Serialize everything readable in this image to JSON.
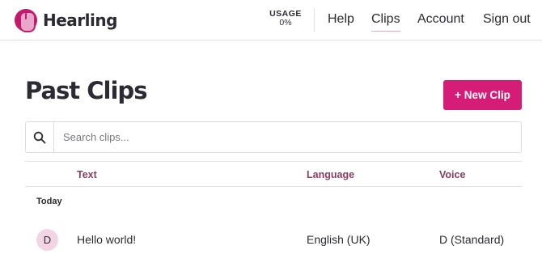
{
  "header": {
    "brand": "Hearling",
    "usage_label": "USAGE",
    "usage_value": "0%",
    "nav": {
      "help": "Help",
      "clips": "Clips",
      "account": "Account",
      "sign_out": "Sign out"
    }
  },
  "main": {
    "title": "Past Clips",
    "new_clip_label": "+ New Clip",
    "search_placeholder": "Search clips...",
    "search_value": "",
    "columns": {
      "text": "Text",
      "language": "Language",
      "voice": "Voice"
    },
    "groups": [
      {
        "label": "Today",
        "clips": [
          {
            "avatar": "D",
            "text": "Hello world!",
            "language": "English (UK)",
            "voice": "D (Standard)"
          }
        ]
      }
    ]
  },
  "colors": {
    "accent": "#d51d78",
    "brand_logo": "#c21a6d",
    "column_header": "#8a3d64",
    "avatar_bg": "#f3d4e4",
    "text": "#2c2a33"
  },
  "icons": {
    "logo": "hearling-logo-icon",
    "search": "search-icon"
  }
}
